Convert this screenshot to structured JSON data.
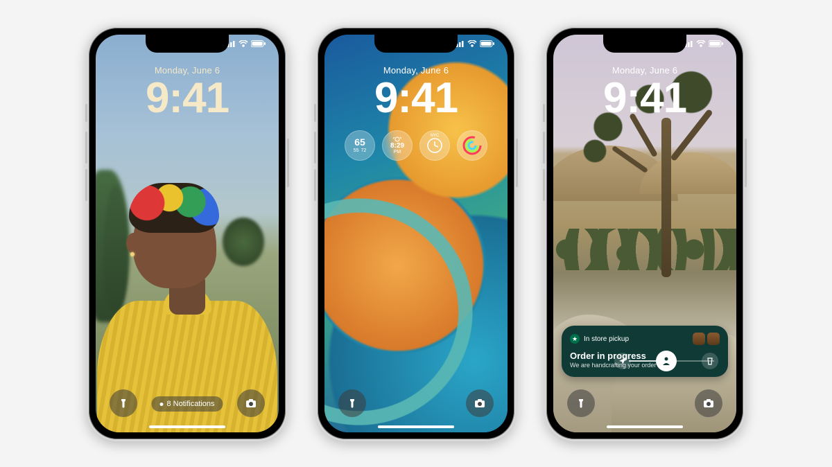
{
  "common": {
    "date": "Monday, June 6",
    "time": "9:41"
  },
  "phone1": {
    "notifications_label": "8 Notifications"
  },
  "phone2": {
    "widgets": {
      "weather": {
        "temp": "65",
        "low": "55",
        "high": "72"
      },
      "clock": {
        "time": "8:29",
        "ampm": "PM"
      },
      "worldclock": {
        "city": "NYC"
      }
    }
  },
  "phone3": {
    "live_activity": {
      "brand_label": "In store pickup",
      "title": "Order in progress",
      "subtitle": "We are handcrafting your order"
    }
  }
}
